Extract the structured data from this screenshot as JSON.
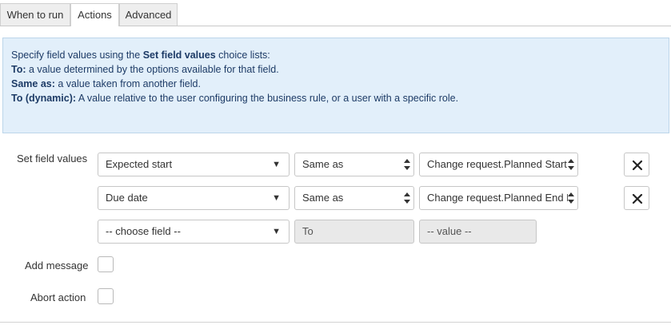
{
  "tabs": [
    {
      "label": "When to run"
    },
    {
      "label": "Actions"
    },
    {
      "label": "Advanced"
    }
  ],
  "active_tab": "Actions",
  "info": {
    "line1_prefix": "Specify field values using the ",
    "line1_bold": "Set field values",
    "line1_suffix": " choice lists:",
    "to_bold": "To:",
    "to_text": " a value determined by the options available for that field.",
    "same_bold": "Same as:",
    "same_text": " a value taken from another field.",
    "dyn_bold": "To (dynamic):",
    "dyn_text": " A value relative to the user configuring the business rule, or a user with a specific role."
  },
  "set_field_values_label": "Set field values",
  "rows": [
    {
      "field": "Expected start",
      "operator": "Same as",
      "value": "Change request.Planned Start"
    },
    {
      "field": "Due date",
      "operator": "Same as",
      "value": "Change request.Planned End D"
    }
  ],
  "new_row": {
    "field": "-- choose field --",
    "operator": "To",
    "value": "-- value --"
  },
  "add_message_label": "Add message",
  "abort_action_label": "Abort action",
  "icons": {
    "caret": "caret-down-icon",
    "stepper": "updown-stepper-icon",
    "remove": "close-icon"
  },
  "colors": {
    "info_bg": "#e2effa",
    "info_border": "#bcd5ea",
    "info_text": "#1d3b66"
  }
}
